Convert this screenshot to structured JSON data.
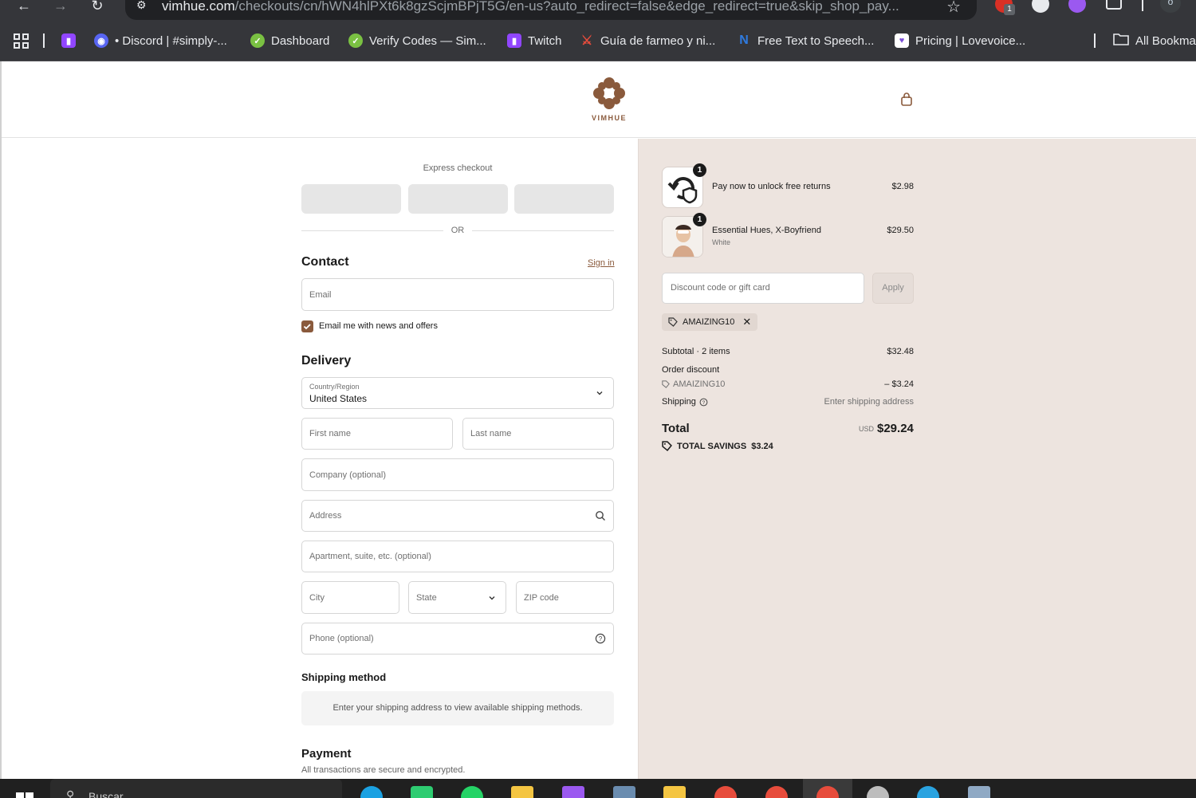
{
  "browser": {
    "url_host": "vimhue.com",
    "url_path": "/checkouts/cn/hWN4hlPXt6k8gzScjmBPjT5G/en-us?auto_redirect=false&edge_redirect=true&skip_shop_pay...",
    "extension_badge": "1",
    "profile_initial": "o",
    "bookmarks": [
      {
        "label": "• Discord | #simply-...",
        "icon": "discord-icon",
        "color": "#5865f2"
      },
      {
        "label": "Dashboard",
        "icon": "checkmark-leaf-icon",
        "color": "#7ac142"
      },
      {
        "label": "Verify Codes — Sim...",
        "icon": "checkmark-leaf-icon",
        "color": "#7ac142"
      },
      {
        "label": "Twitch",
        "icon": "twitch-icon",
        "color": "#9146ff"
      },
      {
        "label": "Guía de farmeo y ni...",
        "icon": "sword-icon",
        "color": "#c0392b"
      },
      {
        "label": "Free Text to Speech...",
        "icon": "n-logo-icon",
        "color": "#1e63c6"
      },
      {
        "label": "Pricing | Lovevoice...",
        "icon": "heart-icon",
        "color": "#7b4fd6"
      }
    ],
    "all_bookmarks": "All Bookma"
  },
  "store": {
    "logo_text": "VIMHUE"
  },
  "express": {
    "title": "Express checkout",
    "or": "OR"
  },
  "contact": {
    "heading": "Contact",
    "sign_in": "Sign in",
    "email_placeholder": "Email",
    "newsletter_label": "Email me with news and offers",
    "newsletter_checked": true
  },
  "delivery": {
    "heading": "Delivery",
    "country_label": "Country/Region",
    "country_value": "United States",
    "first_name": "First name",
    "last_name": "Last name",
    "company": "Company (optional)",
    "address": "Address",
    "apartment": "Apartment, suite, etc. (optional)",
    "city": "City",
    "state": "State",
    "zip": "ZIP code",
    "phone": "Phone (optional)"
  },
  "shipping": {
    "heading": "Shipping method",
    "message": "Enter your shipping address to view available shipping methods."
  },
  "payment": {
    "heading": "Payment",
    "subtitle": "All transactions are secure and encrypted."
  },
  "summary": {
    "items": [
      {
        "title": "Pay now to unlock free returns",
        "variant": "",
        "price": "$2.98",
        "qty": "1"
      },
      {
        "title": "Essential Hues, X-Boyfriend",
        "variant": "White",
        "price": "$29.50",
        "qty": "1"
      }
    ],
    "discount_placeholder": "Discount code or gift card",
    "apply": "Apply",
    "applied_code": "AMAIZING10",
    "subtotal_label": "Subtotal · 2 items",
    "subtotal_value": "$32.48",
    "order_discount_label": "Order discount",
    "order_discount_code": "AMAIZING10",
    "order_discount_value": "– $3.24",
    "shipping_label": "Shipping",
    "shipping_value": "Enter shipping address",
    "total_label": "Total",
    "total_currency": "USD",
    "total_value": "$29.24",
    "savings_label": "TOTAL SAVINGS",
    "savings_value": "$3.24"
  },
  "colors": {
    "brand": "#8a5a3c",
    "summary_bg": "#ede4df"
  },
  "taskbar": {
    "search_text": "Buscar"
  }
}
